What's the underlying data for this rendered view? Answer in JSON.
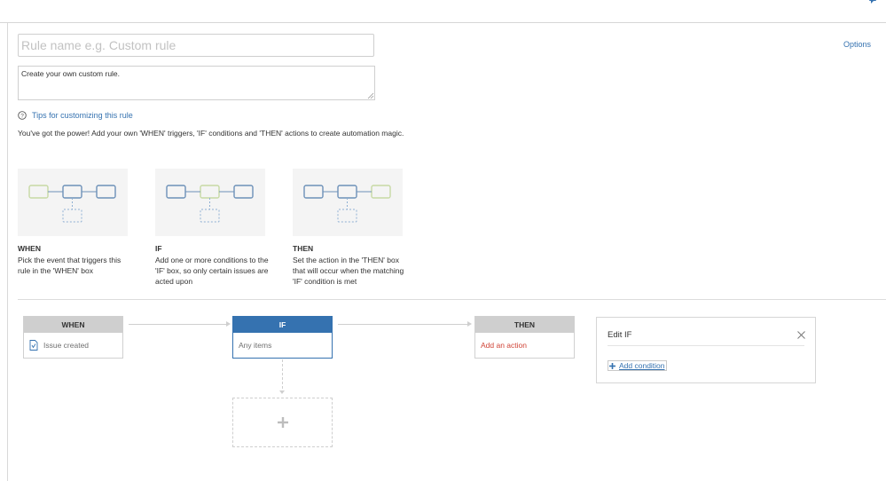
{
  "rule": {
    "name_placeholder": "Rule name e.g. Custom rule",
    "name_value": "",
    "description_value": "Create your own custom rule.",
    "options_label": "Options"
  },
  "tips": {
    "label": "Tips for customizing this rule",
    "intro": "You've got the power! Add your own 'WHEN' triggers, 'IF' conditions and 'THEN' actions to create automation magic."
  },
  "cards": [
    {
      "title": "WHEN",
      "desc": "Pick the event that triggers this rule in the 'WHEN' box"
    },
    {
      "title": "IF",
      "desc": "Add one or more conditions to the 'IF' box, so only certain issues are acted upon"
    },
    {
      "title": "THEN",
      "desc": "Set the action in the 'THEN' box that will occur when the matching 'IF' condition is met"
    }
  ],
  "flow": {
    "when": {
      "header": "WHEN",
      "body": "Issue created"
    },
    "if": {
      "header": "IF",
      "body": "Any items"
    },
    "then": {
      "header": "THEN",
      "body": "Add an action"
    }
  },
  "panel": {
    "title": "Edit IF",
    "add_condition": "Add condition"
  },
  "colors": {
    "accent": "#3572b0",
    "action_red": "#d04437",
    "diagram_green": "#c7d9a4",
    "diagram_blue": "#6d91b8"
  }
}
